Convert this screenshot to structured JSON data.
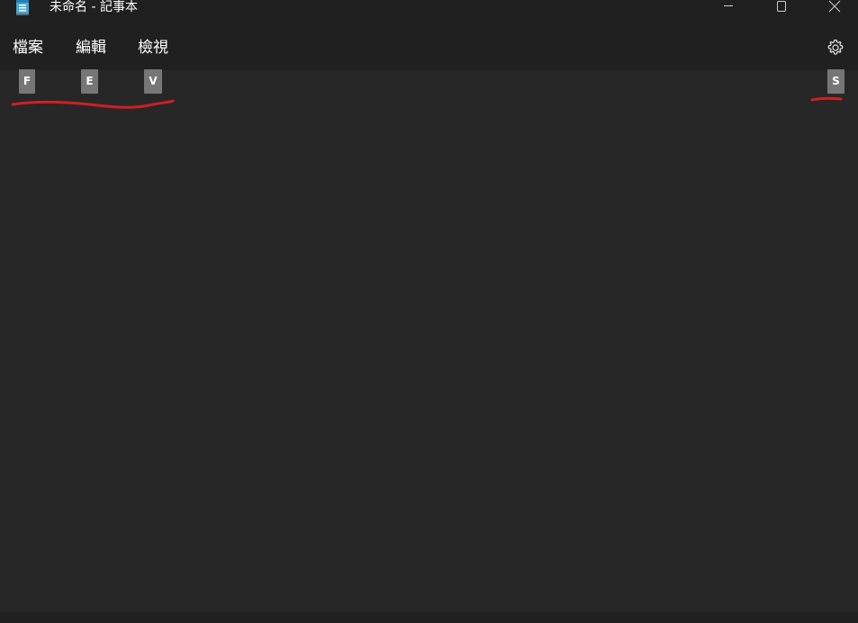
{
  "window": {
    "title": "未命名 - 記事本",
    "app_icon": "notepad-icon",
    "controls": {
      "minimize_icon": "minimize-icon",
      "maximize_icon": "maximize-icon",
      "close_icon": "close-icon"
    }
  },
  "menu": {
    "items": [
      {
        "label": "檔案",
        "keytip": "F"
      },
      {
        "label": "編輯",
        "keytip": "E"
      },
      {
        "label": "檢視",
        "keytip": "V"
      }
    ],
    "settings": {
      "icon": "gear-icon",
      "keytip": "S"
    }
  },
  "editor": {
    "content": ""
  },
  "colors": {
    "background": "#272727",
    "titlebar": "#202020",
    "keytip_bg": "#767676",
    "annotation": "#d01f24"
  }
}
